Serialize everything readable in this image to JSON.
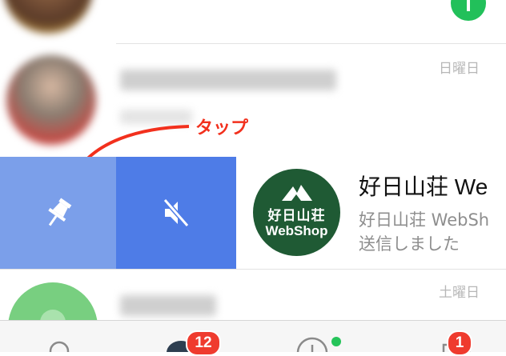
{
  "chats": [
    {
      "date": "",
      "has_unread_indicator": true
    },
    {
      "date": "日曜日"
    },
    {
      "title": "好日山荘 We",
      "preview_line1": "好日山荘 WebSh",
      "preview_line2": "送信しました",
      "logo_text_1": "好日山荘",
      "logo_text_2": "WebShop"
    },
    {
      "date": "土曜日"
    }
  ],
  "swipe_actions": [
    {
      "icon": "pin-icon"
    },
    {
      "icon": "mute-icon"
    }
  ],
  "annotation": {
    "label": "タップ",
    "color": "#f2301d"
  },
  "tabbar": {
    "tabs": [
      {
        "icon": "friends-icon"
      },
      {
        "icon": "chats-icon",
        "badge": "12"
      },
      {
        "icon": "timeline-icon",
        "dot": true
      },
      {
        "icon": "wallet-icon",
        "badge": "1"
      }
    ]
  },
  "colors": {
    "pin_bg": "#7b9fea",
    "mute_bg": "#4e7ce7",
    "badge": "#ef3b2e",
    "online_dot": "#26c45a"
  }
}
